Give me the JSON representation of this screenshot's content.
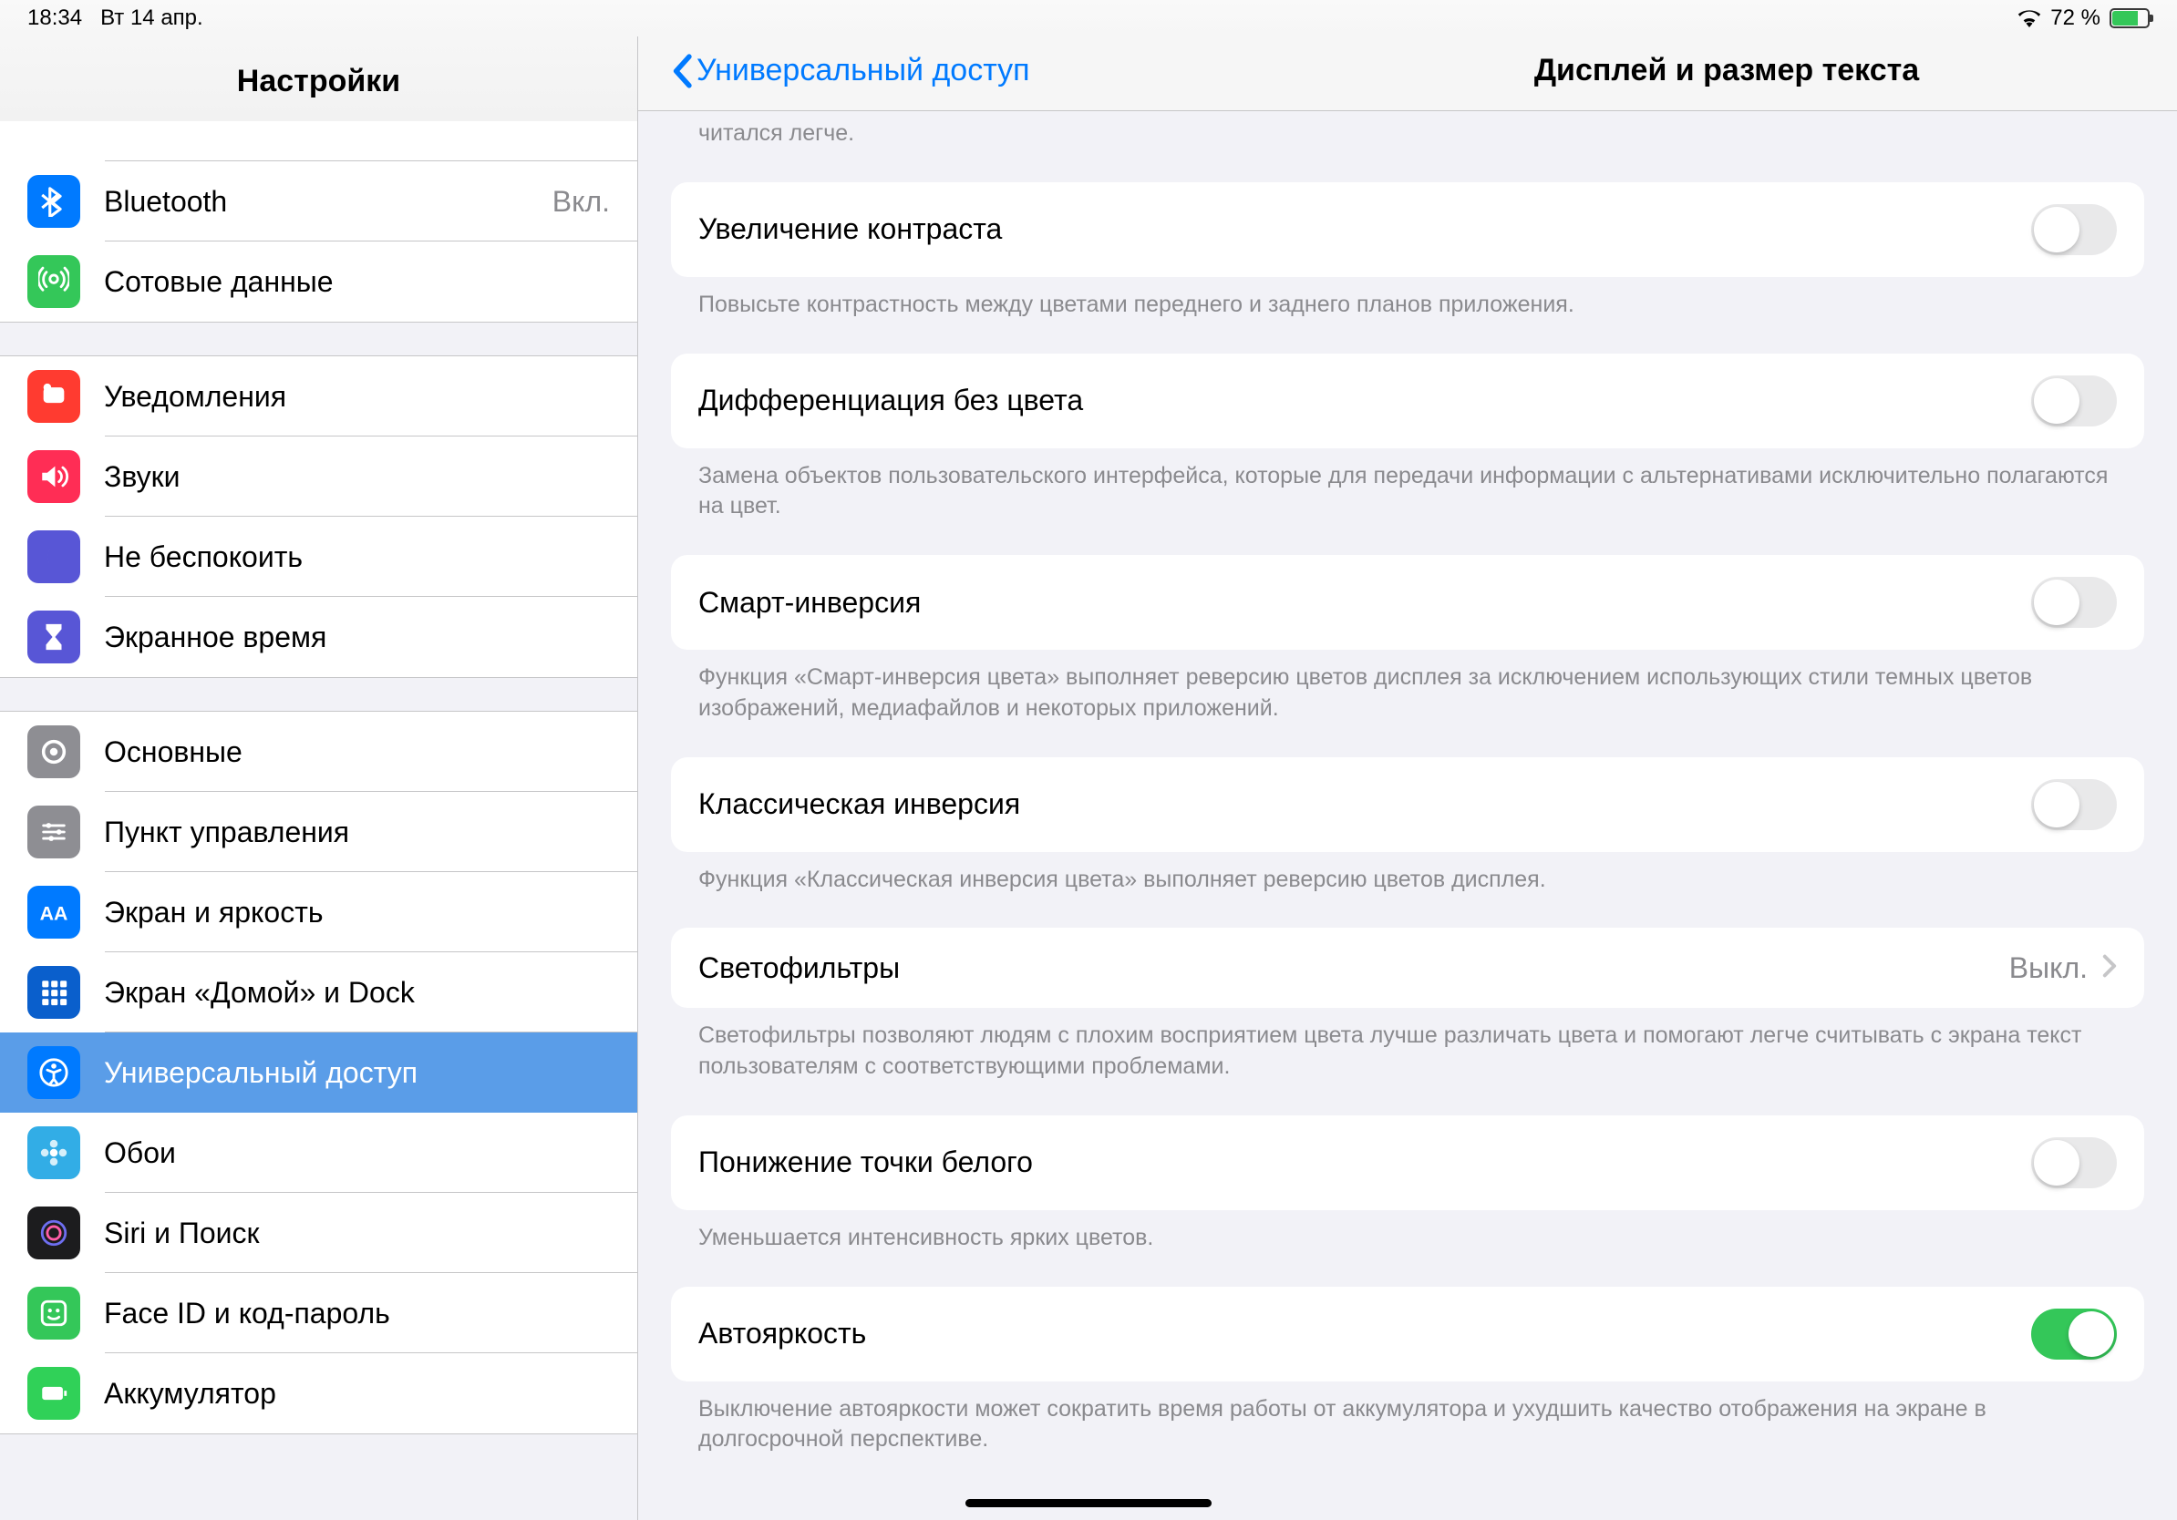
{
  "status": {
    "time": "18:34",
    "date": "Вт 14 апр.",
    "battery": "72 %"
  },
  "sidebar": {
    "title": "Настройки",
    "g1": [
      {
        "label": "Bluetooth",
        "detail": "Вкл.",
        "color": "c-blue",
        "icon": "bluetooth"
      },
      {
        "label": "Сотовые данные",
        "color": "c-green",
        "icon": "antenna"
      }
    ],
    "g2": [
      {
        "label": "Уведомления",
        "color": "c-red",
        "icon": "bell"
      },
      {
        "label": "Звуки",
        "color": "c-pink",
        "icon": "speaker"
      },
      {
        "label": "Не беспокоить",
        "color": "c-purple",
        "icon": "moon"
      },
      {
        "label": "Экранное время",
        "color": "c-purple",
        "icon": "hourglass"
      }
    ],
    "g3": [
      {
        "label": "Основные",
        "color": "c-gray",
        "icon": "gear"
      },
      {
        "label": "Пункт управления",
        "color": "c-gray",
        "icon": "sliders"
      },
      {
        "label": "Экран и яркость",
        "color": "c-blue",
        "icon": "aa"
      },
      {
        "label": "Экран «Домой» и Dock",
        "color": "c-dblue",
        "icon": "grid"
      },
      {
        "label": "Универсальный доступ",
        "color": "c-blue",
        "icon": "access",
        "selected": true
      },
      {
        "label": "Обои",
        "color": "c-teal",
        "icon": "flower"
      },
      {
        "label": "Siri и Поиск",
        "color": "c-dark",
        "icon": "siri"
      },
      {
        "label": "Face ID и код-пароль",
        "color": "c-green",
        "icon": "face"
      },
      {
        "label": "Аккумулятор",
        "color": "c-lgreen",
        "icon": "battery"
      }
    ]
  },
  "main": {
    "back": "Универсальный доступ",
    "title": "Дисплей и размер текста",
    "partial_caption": "читался легче.",
    "items": [
      {
        "label": "Увеличение контраста",
        "type": "toggle",
        "on": false,
        "caption": "Повысьте контрастность между цветами переднего и заднего планов приложения."
      },
      {
        "label": "Дифференциация без цвета",
        "type": "toggle",
        "on": false,
        "caption": "Замена объектов пользовательского интерфейса, которые для передачи информации с альтернативами исключительно полагаются на цвет."
      },
      {
        "label": "Смарт-инверсия",
        "type": "toggle",
        "on": false,
        "caption": "Функция «Смарт-инверсия цвета» выполняет реверсию цветов дисплея за исключением использующих стили темных цветов изображений, медиафайлов и некоторых приложений."
      },
      {
        "label": "Классическая инверсия",
        "type": "toggle",
        "on": false,
        "caption": "Функция «Классическая инверсия цвета» выполняет реверсию цветов дисплея."
      },
      {
        "label": "Светофильтры",
        "type": "link",
        "value": "Выкл.",
        "caption": "Светофильтры позволяют людям с плохим восприятием цвета лучше различать цвета и помогают легче считывать с экрана текст пользователям с соответствующими проблемами."
      },
      {
        "label": "Понижение точки белого",
        "type": "toggle",
        "on": false,
        "caption": "Уменьшается интенсивность ярких цветов."
      },
      {
        "label": "Автояркость",
        "type": "toggle",
        "on": true,
        "caption": "Выключение автояркости может сократить время работы от аккумулятора и ухудшить качество отображения на экране в долгосрочной перспективе."
      }
    ]
  }
}
